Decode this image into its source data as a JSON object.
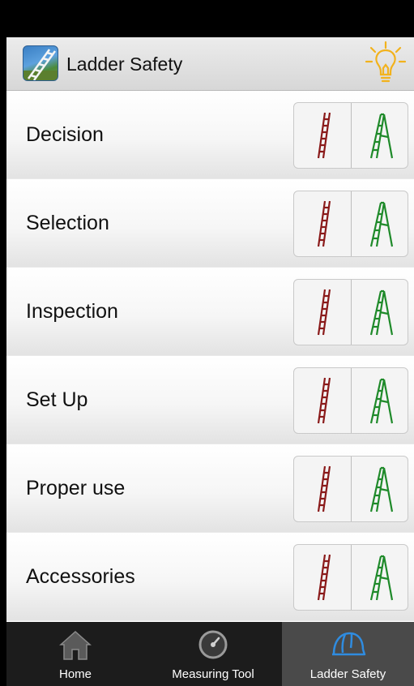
{
  "app": {
    "title": "Ladder Safety"
  },
  "rows": [
    {
      "label": "Decision"
    },
    {
      "label": "Selection"
    },
    {
      "label": "Inspection"
    },
    {
      "label": "Set Up"
    },
    {
      "label": "Proper use"
    },
    {
      "label": "Accessories"
    }
  ],
  "tabs": [
    {
      "label": "Home",
      "icon": "home-icon"
    },
    {
      "label": "Measuring Tool",
      "icon": "gauge-icon"
    },
    {
      "label": "Ladder Safety",
      "icon": "hard-hat-icon",
      "active": true
    }
  ],
  "colors": {
    "extension_ladder": "#8a1a1a",
    "step_ladder": "#1f8a2a",
    "bulb": "#f2b21c",
    "active_tab": "#4a4a4a",
    "hard_hat": "#2f8ce0"
  }
}
